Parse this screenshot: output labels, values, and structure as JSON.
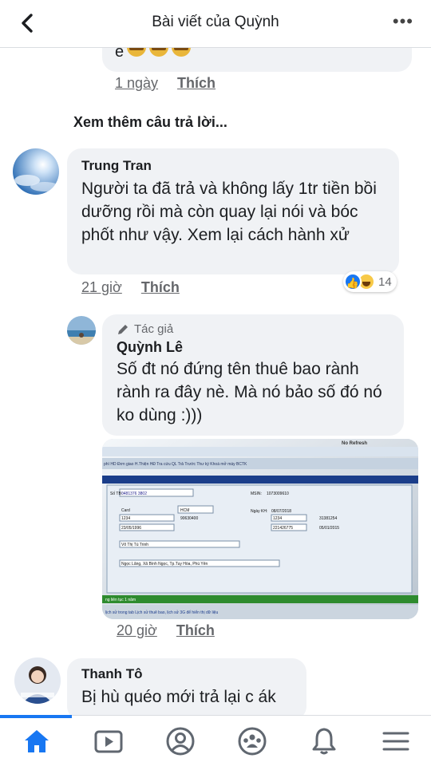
{
  "header": {
    "title": "Bài viết của Quỳnh"
  },
  "top_reply": {
    "tail_text": "e",
    "time": "1 ngày",
    "like": "Thích"
  },
  "see_more": "Xem thêm câu trả lời...",
  "comments": [
    {
      "author": "Trung Tran",
      "text": "Người ta đã trả và không lấy 1tr tiền bồi dưỡng rồi mà còn quay lại nói và bóc phốt như vậy. Xem lại cách hành xử",
      "time": "21 giờ",
      "like": "Thích",
      "reaction_count": "14"
    },
    {
      "badge": "Tác giả",
      "author": "Quỳnh Lê",
      "text": " Số đt nó đứng tên thuê bao rành rành ra đây nè. Mà nó bảo số đó nó ko dùng :)))",
      "time": "20 giờ",
      "like": "Thích"
    },
    {
      "author": "Thanh Tô",
      "text": "Bị hù quéo mới trả lại c ák"
    }
  ],
  "screenshot_photo": {
    "window_title": "No Refresh",
    "menu": "phí HD  Đơn giao  H.Thiện HĐ  Tra cứu  QL Trả Trước  Thư ký  Khoá mở máy  BCTK",
    "phone_label": "Số TB :",
    "phone_value": "0481376 3802",
    "msin_label": "MSIN:",
    "msin_value": "1073009610",
    "date_label": "Ngày KH:",
    "date_value": "08/07/2018",
    "card_value": "Card",
    "province_value": "HCM",
    "pin_value": "1234",
    "puk_value": "90630400",
    "pin2_value": "1234",
    "puk2_value": "31381254",
    "dob_value": "23/05/1996",
    "id_value": "221426775",
    "id_date_value": "05/01/2015",
    "name_value": "Võ Thị Tú Trinh",
    "address_value": "Ngọc Lãng, Xã Bình Ngọc, Tp.Tuy Hòa, Phú Yên",
    "footer_left": "ng liên tục 1 năm",
    "footer_link": "lịch sử trong tab Lịch sử thuê bao, lịch sử 3G để hiển thị dữ liệu"
  },
  "colors": {
    "accent": "#1877f2",
    "bubble": "#f0f2f5",
    "meta": "#65676b"
  },
  "tabbar": [
    "home-icon",
    "watch-icon",
    "profile-icon",
    "groups-icon",
    "notifications-icon",
    "menu-icon"
  ]
}
